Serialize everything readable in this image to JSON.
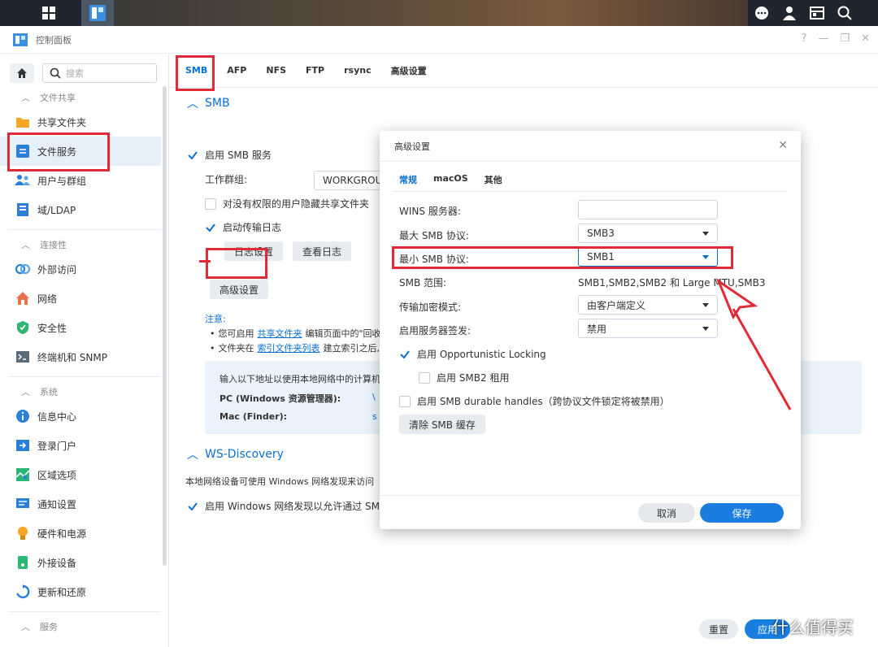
{
  "window": {
    "title": "控制面板"
  },
  "sidebar": {
    "search_placeholder": "搜索",
    "sections": [
      {
        "label": "文件共享",
        "items": [
          {
            "label": "共享文件夹"
          },
          {
            "label": "文件服务"
          },
          {
            "label": "用户与群组"
          },
          {
            "label": "域/LDAP"
          }
        ]
      },
      {
        "label": "连接性",
        "items": [
          {
            "label": "外部访问"
          },
          {
            "label": "网络"
          },
          {
            "label": "安全性"
          },
          {
            "label": "终端机和 SNMP"
          }
        ]
      },
      {
        "label": "系统",
        "items": [
          {
            "label": "信息中心"
          },
          {
            "label": "登录门户"
          },
          {
            "label": "区域选项"
          },
          {
            "label": "通知设置"
          },
          {
            "label": "硬件和电源"
          },
          {
            "label": "外接设备"
          },
          {
            "label": "更新和还原"
          }
        ]
      },
      {
        "label": "服务"
      }
    ]
  },
  "main": {
    "tabs": [
      "SMB",
      "AFP",
      "NFS",
      "FTP",
      "rsync",
      "高级设置"
    ],
    "smb": {
      "header": "SMB",
      "enable_label": "启用 SMB 服务",
      "workgroup_label": "工作群组:",
      "workgroup_value": "WORKGROU",
      "hide_label": "对没有权限的用户隐藏共享文件夹",
      "log_label": "启动传输日志",
      "log_settings": "日志设置",
      "view_log": "查看日志",
      "advanced": "高级设置",
      "note_title": "注意:",
      "note1_pre": "您可启用",
      "note1_link": "共享文件夹",
      "note1_post": "编辑页面中的\"回收",
      "note2_pre": "文件夹在",
      "note2_link": "索引文件夹列表",
      "note2_post": "建立索引之后,",
      "info_line": "输入以下地址以使用本地网络中的计算机",
      "pc_label": "PC (Windows 资源管理器):",
      "pc_value": "\\",
      "mac_label": "Mac (Finder):",
      "mac_value": "s"
    },
    "ws": {
      "header": "WS-Discovery",
      "desc": "本地网络设备可使用 Windows 网络发现来访问",
      "enable_label": "启用 Windows 网络发现以允许通过 SMB"
    }
  },
  "dialog": {
    "title": "高级设置",
    "tabs": [
      "常规",
      "macOS",
      "其他"
    ],
    "wins_label": "WINS 服务器:",
    "wins_value": "",
    "max_label": "最大 SMB 协议:",
    "max_value": "SMB3",
    "min_label": "最小 SMB 协议:",
    "min_value": "SMB1",
    "range_label": "SMB 范围:",
    "range_value": "SMB1,SMB2,SMB2 和 Large MTU,SMB3",
    "enc_label": "传输加密模式:",
    "enc_value": "由客户端定义",
    "sign_label": "启用服务器签发:",
    "sign_value": "禁用",
    "oplock_label": "启用 Opportunistic Locking",
    "lease_label": "启用 SMB2 租用",
    "durable_label": "启用 SMB durable handles（跨协议文件锁定将被禁用）",
    "clear_cache": "清除 SMB 缓存",
    "cancel": "取消",
    "save": "保存"
  },
  "bottom": {
    "reset": "重置",
    "apply": "应用"
  },
  "watermark": "什么值得买",
  "colors": {
    "accent": "#0a6fd0",
    "highlight": "#e02b36",
    "primary_button": "#1a7ee0"
  }
}
